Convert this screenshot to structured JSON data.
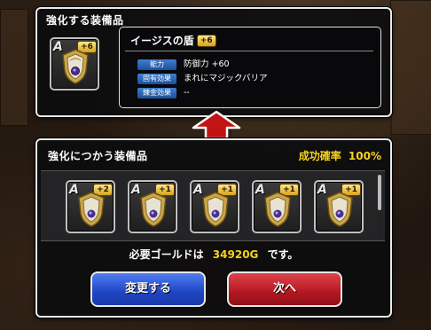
{
  "top_panel": {
    "title": "強化する装備品",
    "item": {
      "rank": "A",
      "plus": "+6",
      "name": "イージスの盾"
    },
    "stats": [
      {
        "label": "能力",
        "value": "防御力 +60"
      },
      {
        "label": "固有効果",
        "value": "まれにマジックバリア"
      },
      {
        "label": "錬金効果",
        "value": "--"
      }
    ]
  },
  "bottom_panel": {
    "title": "強化につかう装備品",
    "success_label": "成功確率",
    "success_rate": "100%",
    "materials": [
      {
        "rank": "A",
        "plus": "+2"
      },
      {
        "rank": "A",
        "plus": "+1"
      },
      {
        "rank": "A",
        "plus": "+1"
      },
      {
        "rank": "A",
        "plus": "+1"
      },
      {
        "rank": "A",
        "plus": "+1"
      }
    ],
    "gold_prefix": "必要ゴールドは",
    "gold_amount": "34920G",
    "gold_suffix": "です。",
    "change_button": "変更する",
    "next_button": "次へ"
  },
  "colors": {
    "accent_yellow": "#f6d21a",
    "button_blue": "#2a55d8",
    "button_red": "#b31822",
    "arrow_red": "#c11515"
  }
}
